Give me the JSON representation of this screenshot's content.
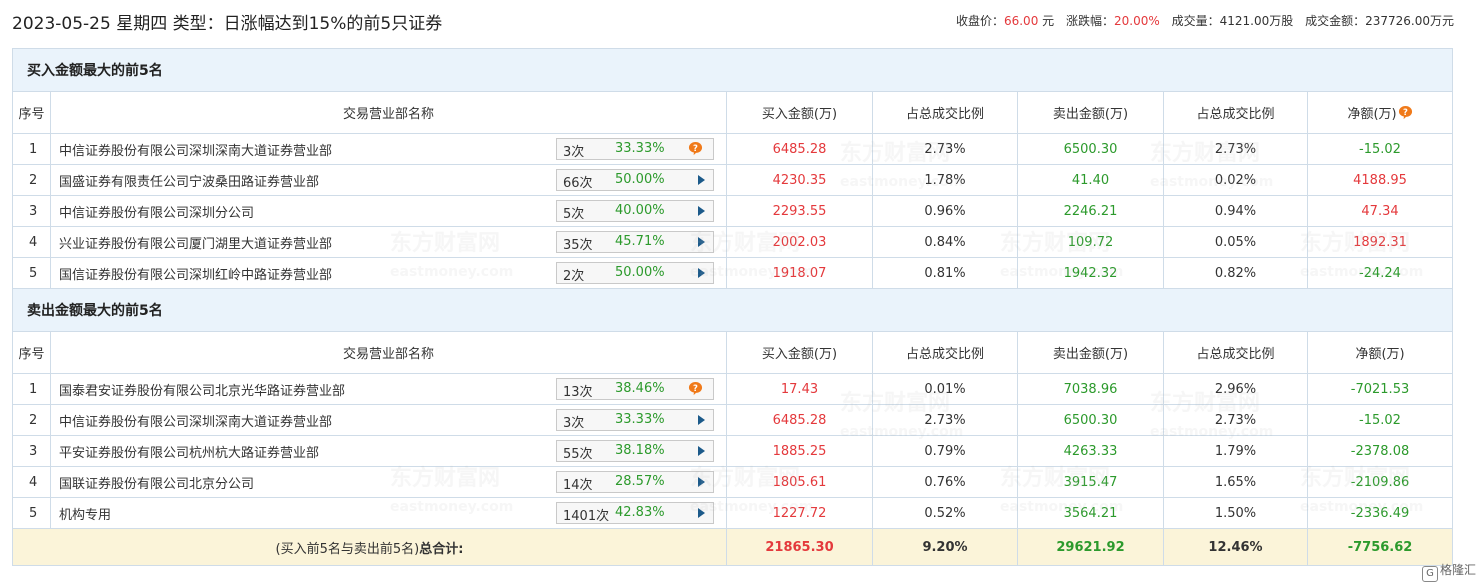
{
  "title": "2023-05-25 星期四 类型：日涨幅达到15%的前5只证券",
  "summary": {
    "close_label": "收盘价：",
    "close_value": "66.00",
    "close_unit": "元",
    "change_label": "涨跌幅：",
    "change_value": "20.00%",
    "volume_label": "成交量：",
    "volume_value": "4121.00万股",
    "amount_label": "成交金额：",
    "amount_value": "237726.00万元"
  },
  "headers": {
    "index": "序号",
    "name": "交易营业部名称",
    "buy": "买入金额(万)",
    "buy_ratio": "占总成交比例",
    "sell": "卖出金额(万)",
    "sell_ratio": "占总成交比例",
    "net": "净额(万)"
  },
  "buy_section": {
    "title": "买入金额最大的前5名",
    "rows": [
      {
        "index": "1",
        "name": "中信证券股份有限公司深圳深南大道证券营业部",
        "count": "3次",
        "rate": "33.33%",
        "icon": "question-icon",
        "buy": "6485.28",
        "buy_ratio": "2.73%",
        "sell": "6500.30",
        "sell_ratio": "2.73%",
        "net": "-15.02",
        "net_color": "green"
      },
      {
        "index": "2",
        "name": "国盛证券有限责任公司宁波桑田路证券营业部",
        "count": "66次",
        "rate": "50.00%",
        "icon": "arrow-right-icon",
        "buy": "4230.35",
        "buy_ratio": "1.78%",
        "sell": "41.40",
        "sell_ratio": "0.02%",
        "net": "4188.95",
        "net_color": "red"
      },
      {
        "index": "3",
        "name": "中信证券股份有限公司深圳分公司",
        "count": "5次",
        "rate": "40.00%",
        "icon": "arrow-right-icon",
        "buy": "2293.55",
        "buy_ratio": "0.96%",
        "sell": "2246.21",
        "sell_ratio": "0.94%",
        "net": "47.34",
        "net_color": "red"
      },
      {
        "index": "4",
        "name": "兴业证券股份有限公司厦门湖里大道证券营业部",
        "count": "35次",
        "rate": "45.71%",
        "icon": "arrow-right-icon",
        "buy": "2002.03",
        "buy_ratio": "0.84%",
        "sell": "109.72",
        "sell_ratio": "0.05%",
        "net": "1892.31",
        "net_color": "red"
      },
      {
        "index": "5",
        "name": "国信证券股份有限公司深圳红岭中路证券营业部",
        "count": "2次",
        "rate": "50.00%",
        "icon": "arrow-right-icon",
        "buy": "1918.07",
        "buy_ratio": "0.81%",
        "sell": "1942.32",
        "sell_ratio": "0.82%",
        "net": "-24.24",
        "net_color": "green"
      }
    ]
  },
  "sell_section": {
    "title": "卖出金额最大的前5名",
    "rows": [
      {
        "index": "1",
        "name": "国泰君安证券股份有限公司北京光华路证券营业部",
        "count": "13次",
        "rate": "38.46%",
        "icon": "question-icon",
        "buy": "17.43",
        "buy_ratio": "0.01%",
        "sell": "7038.96",
        "sell_ratio": "2.96%",
        "net": "-7021.53",
        "net_color": "green"
      },
      {
        "index": "2",
        "name": "中信证券股份有限公司深圳深南大道证券营业部",
        "count": "3次",
        "rate": "33.33%",
        "icon": "arrow-right-icon",
        "buy": "6485.28",
        "buy_ratio": "2.73%",
        "sell": "6500.30",
        "sell_ratio": "2.73%",
        "net": "-15.02",
        "net_color": "green"
      },
      {
        "index": "3",
        "name": "平安证券股份有限公司杭州杭大路证券营业部",
        "count": "55次",
        "rate": "38.18%",
        "icon": "arrow-right-icon",
        "buy": "1885.25",
        "buy_ratio": "0.79%",
        "sell": "4263.33",
        "sell_ratio": "1.79%",
        "net": "-2378.08",
        "net_color": "green"
      },
      {
        "index": "4",
        "name": "国联证券股份有限公司北京分公司",
        "count": "14次",
        "rate": "28.57%",
        "icon": "arrow-right-icon",
        "buy": "1805.61",
        "buy_ratio": "0.76%",
        "sell": "3915.47",
        "sell_ratio": "1.65%",
        "net": "-2109.86",
        "net_color": "green"
      },
      {
        "index": "5",
        "name": "机构专用",
        "count": "1401次",
        "rate": "42.83%",
        "icon": "arrow-right-icon",
        "buy": "1227.72",
        "buy_ratio": "0.52%",
        "sell": "3564.21",
        "sell_ratio": "1.50%",
        "net": "-2336.49",
        "net_color": "green"
      }
    ]
  },
  "total": {
    "label_prefix": "(买入前5名与卖出前5名)",
    "label_bold": "总合计:",
    "buy": "21865.30",
    "buy_ratio": "9.20%",
    "sell": "29621.92",
    "sell_ratio": "12.46%",
    "net": "-7756.62"
  },
  "watermark": {
    "cn": "东方财富网",
    "en": "eastmoney.com"
  },
  "corner_logo": "格隆汇",
  "colors": {
    "red": "#e4393c",
    "green": "#2c9a2c",
    "section_bg": "#eaf3fb",
    "total_bg": "#fbf4d9",
    "arrow": "#1c5a8a",
    "question": "#f07a1a"
  }
}
